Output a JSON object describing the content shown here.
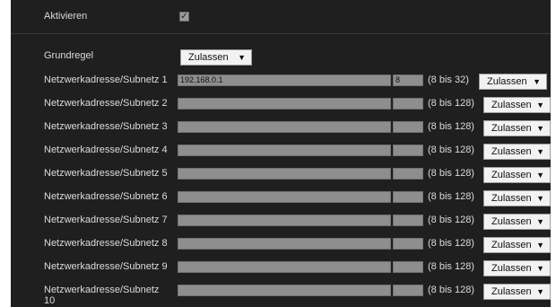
{
  "enable": {
    "label": "Aktivieren",
    "checked": true,
    "check_glyph": "✓"
  },
  "default_rule": {
    "label": "Grundregel",
    "value": "Zulassen"
  },
  "arrow_glyph": "▼",
  "rows": [
    {
      "label": "Netzwerkadresse/Subnetz 1",
      "address": "192.168.0.1",
      "mask": "8",
      "range": "(8 bis 32)",
      "action": "Zulassen"
    },
    {
      "label": "Netzwerkadresse/Subnetz 2",
      "address": "",
      "mask": "",
      "range": "(8 bis 128)",
      "action": "Zulassen"
    },
    {
      "label": "Netzwerkadresse/Subnetz 3",
      "address": "",
      "mask": "",
      "range": "(8 bis 128)",
      "action": "Zulassen"
    },
    {
      "label": "Netzwerkadresse/Subnetz 4",
      "address": "",
      "mask": "",
      "range": "(8 bis 128)",
      "action": "Zulassen"
    },
    {
      "label": "Netzwerkadresse/Subnetz 5",
      "address": "",
      "mask": "",
      "range": "(8 bis 128)",
      "action": "Zulassen"
    },
    {
      "label": "Netzwerkadresse/Subnetz 6",
      "address": "",
      "mask": "",
      "range": "(8 bis 128)",
      "action": "Zulassen"
    },
    {
      "label": "Netzwerkadresse/Subnetz 7",
      "address": "",
      "mask": "",
      "range": "(8 bis 128)",
      "action": "Zulassen"
    },
    {
      "label": "Netzwerkadresse/Subnetz 8",
      "address": "",
      "mask": "",
      "range": "(8 bis 128)",
      "action": "Zulassen"
    },
    {
      "label": "Netzwerkadresse/Subnetz 9",
      "address": "",
      "mask": "",
      "range": "(8 bis 128)",
      "action": "Zulassen"
    },
    {
      "label": "Netzwerkadresse/Subnetz 10",
      "address": "",
      "mask": "",
      "range": "(8 bis 128)",
      "action": "Zulassen"
    }
  ]
}
